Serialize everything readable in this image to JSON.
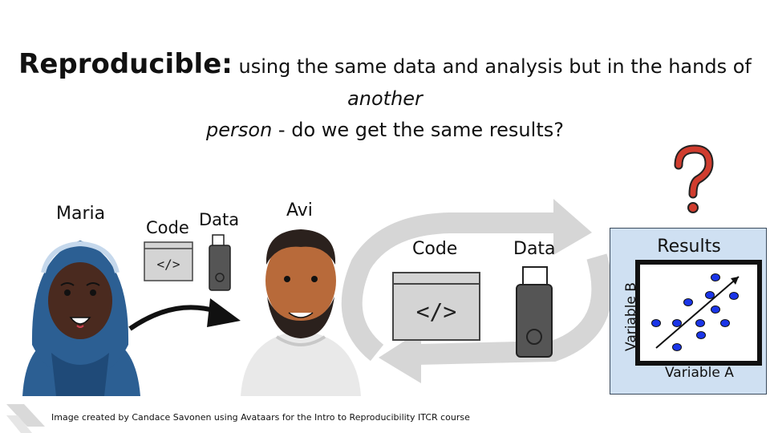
{
  "title": {
    "term": "Reproducible:",
    "line1_text": " using the same data and analysis but in the hands of ",
    "line1_italic": "another",
    "line2_italic": "person",
    "line2_text": " - do we get the same results?"
  },
  "people": {
    "maria": {
      "name": "Maria",
      "code_label": "Code",
      "data_label": "Data"
    },
    "avi": {
      "name": "Avi"
    }
  },
  "cycle": {
    "code_label": "Code",
    "data_label": "Data"
  },
  "results": {
    "title": "Results",
    "x_axis_label": "Variable A",
    "y_axis_label": "Variable B",
    "question_mark": "?"
  },
  "credit": "Image created by Candace Savonen using Avataars for the Intro to Reproducibility ITCR course",
  "colors": {
    "hijab": "#2c5f93",
    "skin_dark": "#4a2a1f",
    "skin_avi": "#b86a3a",
    "hair_avi": "#2b211d",
    "hoodie": "#e9e9e9",
    "question": "#d03c2e",
    "dot": "#1a35e8",
    "results_bg": "#cfe0f2"
  }
}
